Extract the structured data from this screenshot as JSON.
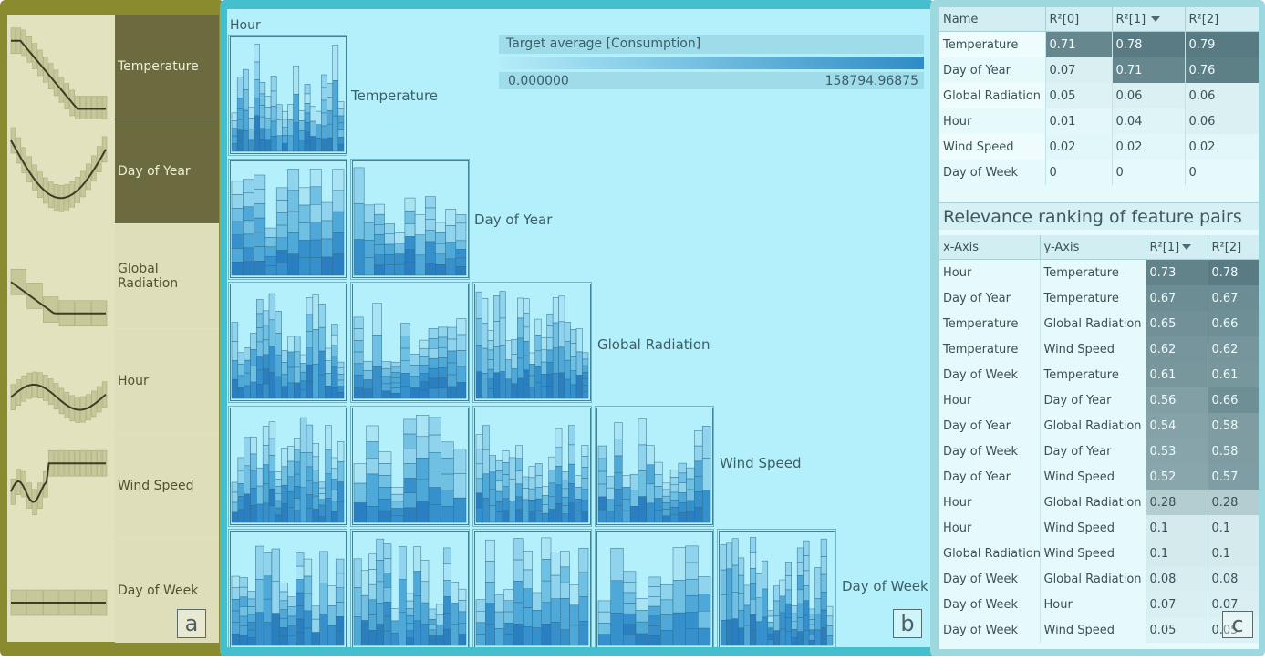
{
  "panel_a": {
    "features": [
      "Temperature",
      "Day of Year",
      "Global Radiation",
      "Hour",
      "Wind Speed",
      "Day of Week"
    ],
    "selected": [
      "Temperature",
      "Day of Year"
    ],
    "badge": "a"
  },
  "panel_b": {
    "hour_label": "Hour",
    "diagonal_labels": [
      "Temperature",
      "Day of Year",
      "Global Radiation",
      "Wind Speed",
      "Day of Week"
    ],
    "legend": {
      "title": "Target average [Consumption]",
      "min": "0.000000",
      "max": "158794.96875",
      "color_low": "#b4ecf8",
      "color_high": "#2e8cc6"
    },
    "badge": "b"
  },
  "panel_c": {
    "single_table": {
      "headers": [
        "Name",
        "R²[0]",
        "R²[1]",
        "R²[2]"
      ],
      "rows": [
        [
          "Temperature",
          "0.71",
          "0.78",
          "0.79"
        ],
        [
          "Day of Year",
          "0.07",
          "0.71",
          "0.76"
        ],
        [
          "Global Radiation",
          "0.05",
          "0.06",
          "0.06"
        ],
        [
          "Hour",
          "0.01",
          "0.04",
          "0.06"
        ],
        [
          "Wind Speed",
          "0.02",
          "0.02",
          "0.02"
        ],
        [
          "Day of Week",
          "0",
          "0",
          "0"
        ]
      ]
    },
    "pair_title": "Relevance ranking of feature pairs",
    "pair_table": {
      "headers": [
        "x-Axis",
        "y-Axis",
        "R²[1]",
        "R²[2]"
      ],
      "rows": [
        [
          "Hour",
          "Temperature",
          "0.73",
          "0.78"
        ],
        [
          "Day of Year",
          "Temperature",
          "0.67",
          "0.67"
        ],
        [
          "Temperature",
          "Global Radiation",
          "0.65",
          "0.66"
        ],
        [
          "Temperature",
          "Wind Speed",
          "0.62",
          "0.62"
        ],
        [
          "Day of Week",
          "Temperature",
          "0.61",
          "0.61"
        ],
        [
          "Hour",
          "Day of Year",
          "0.56",
          "0.66"
        ],
        [
          "Day of Year",
          "Global Radiation",
          "0.54",
          "0.58"
        ],
        [
          "Day of Week",
          "Day of Year",
          "0.53",
          "0.58"
        ],
        [
          "Day of Year",
          "Wind Speed",
          "0.52",
          "0.57"
        ],
        [
          "Hour",
          "Global Radiation",
          "0.28",
          "0.28"
        ],
        [
          "Hour",
          "Wind Speed",
          "0.1",
          "0.1"
        ],
        [
          "Global Radiation",
          "Wind Speed",
          "0.1",
          "0.1"
        ],
        [
          "Day of Week",
          "Global Radiation",
          "0.08",
          "0.08"
        ],
        [
          "Day of Week",
          "Hour",
          "0.07",
          "0.07"
        ],
        [
          "Day of Week",
          "Wind Speed",
          "0.05",
          "0.05"
        ]
      ]
    },
    "badge": "c",
    "accent_dark": "#5a7c84",
    "accent_light": "#e6fafc"
  }
}
